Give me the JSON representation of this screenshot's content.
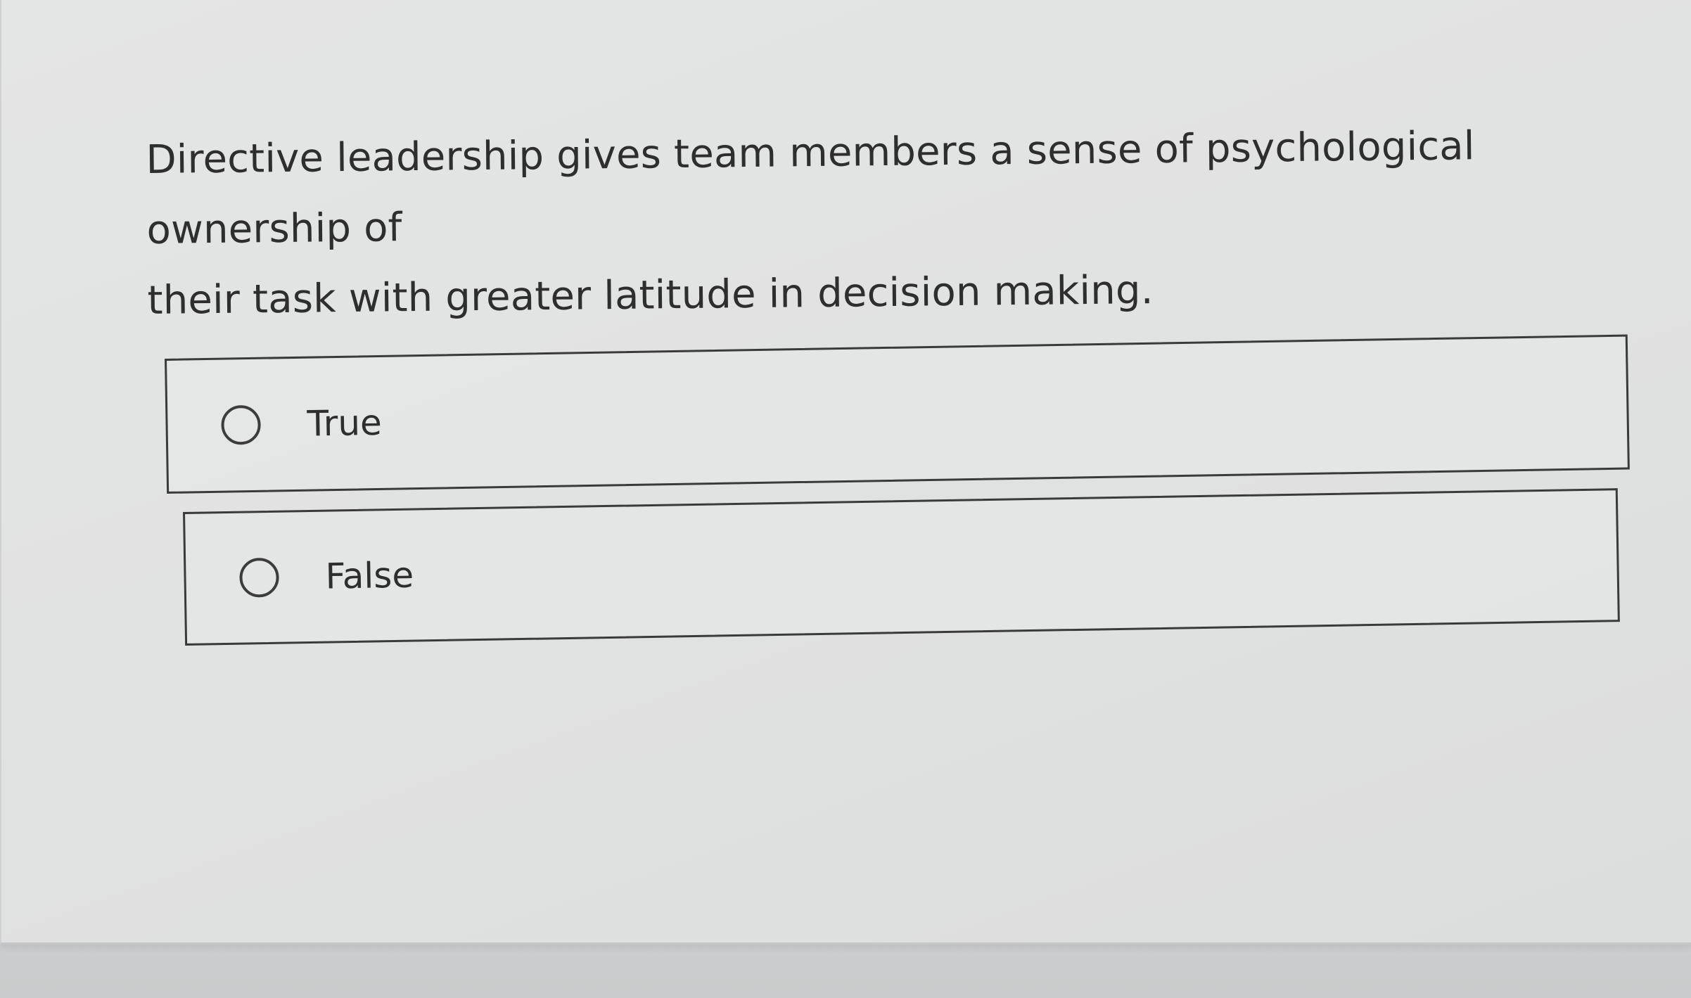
{
  "question": {
    "line1": "Directive leadership gives team members a sense of psychological ownership of",
    "line2": "their task with greater latitude in decision making."
  },
  "options": [
    {
      "label": "True",
      "selected": false
    },
    {
      "label": "False",
      "selected": false
    }
  ],
  "colors": {
    "background": "#e2e3e3",
    "text": "#2e2e2e",
    "border": "#3a3a3a"
  }
}
